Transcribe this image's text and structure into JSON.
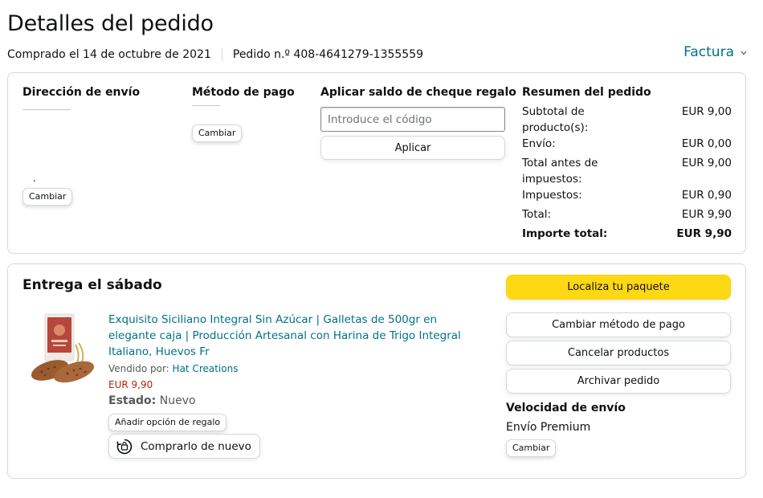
{
  "header": {
    "title": "Detalles del pedido",
    "purchase_date": "Comprado el 14 de octubre de 2021",
    "order_number": "Pedido n.º 408-4641279-1355559",
    "invoice_label": "Factura",
    "invoice_chevron": "chevron-down-icon"
  },
  "shipping": {
    "heading": "Dirección de envío",
    "change_label": "Cambiar"
  },
  "payment": {
    "heading": "Método de pago",
    "change_label": "Cambiar"
  },
  "gift_card": {
    "heading": "Aplicar saldo de cheque regalo",
    "placeholder": "Introduce el código",
    "value": "",
    "apply_label": "Aplicar"
  },
  "summary": {
    "heading": "Resumen del pedido",
    "rows": [
      {
        "label": "Subtotal de producto(s):",
        "value": "EUR 9,00"
      },
      {
        "label": "Envío:",
        "value": "EUR 0,00"
      },
      {
        "label": "Total antes de impuestos:",
        "value": "EUR 9,00"
      },
      {
        "label": "Impuestos:",
        "value": "EUR 0,90"
      },
      {
        "label": "Total:",
        "value": "EUR 9,90"
      }
    ],
    "grand_total": {
      "label": "Importe total:",
      "value": "EUR 9,90"
    }
  },
  "delivery": {
    "title": "Entrega el sábado",
    "product": {
      "title": "Exquisito Siciliano Integral Sin Azúcar | Galletas de 500gr en elegante caja | Producción Artesanal con Harina de Trigo Integral Italiano, Huevos Fr",
      "sold_by_label": "Vendido por:",
      "seller": "Hat Creations",
      "price": "EUR 9,90",
      "status_label": "Estado:",
      "status_value": "Nuevo",
      "gift_option_label": "Añadir opción de regalo",
      "buy_again_label": "Comprarlo de nuevo",
      "buy_again_icon": "buy-again-icon",
      "image_icon": "product-image"
    },
    "actions": {
      "track": "Localiza tu paquete",
      "change_payment": "Cambiar método de pago",
      "cancel": "Cancelar productos",
      "archive": "Archivar pedido"
    },
    "shipping_speed": {
      "heading": "Velocidad de envío",
      "value": "Envío Premium",
      "change_label": "Cambiar"
    }
  },
  "colors": {
    "link": "#007185",
    "price": "#b12704",
    "primary_button": "#ffd814",
    "border": "#d5d9d9"
  }
}
